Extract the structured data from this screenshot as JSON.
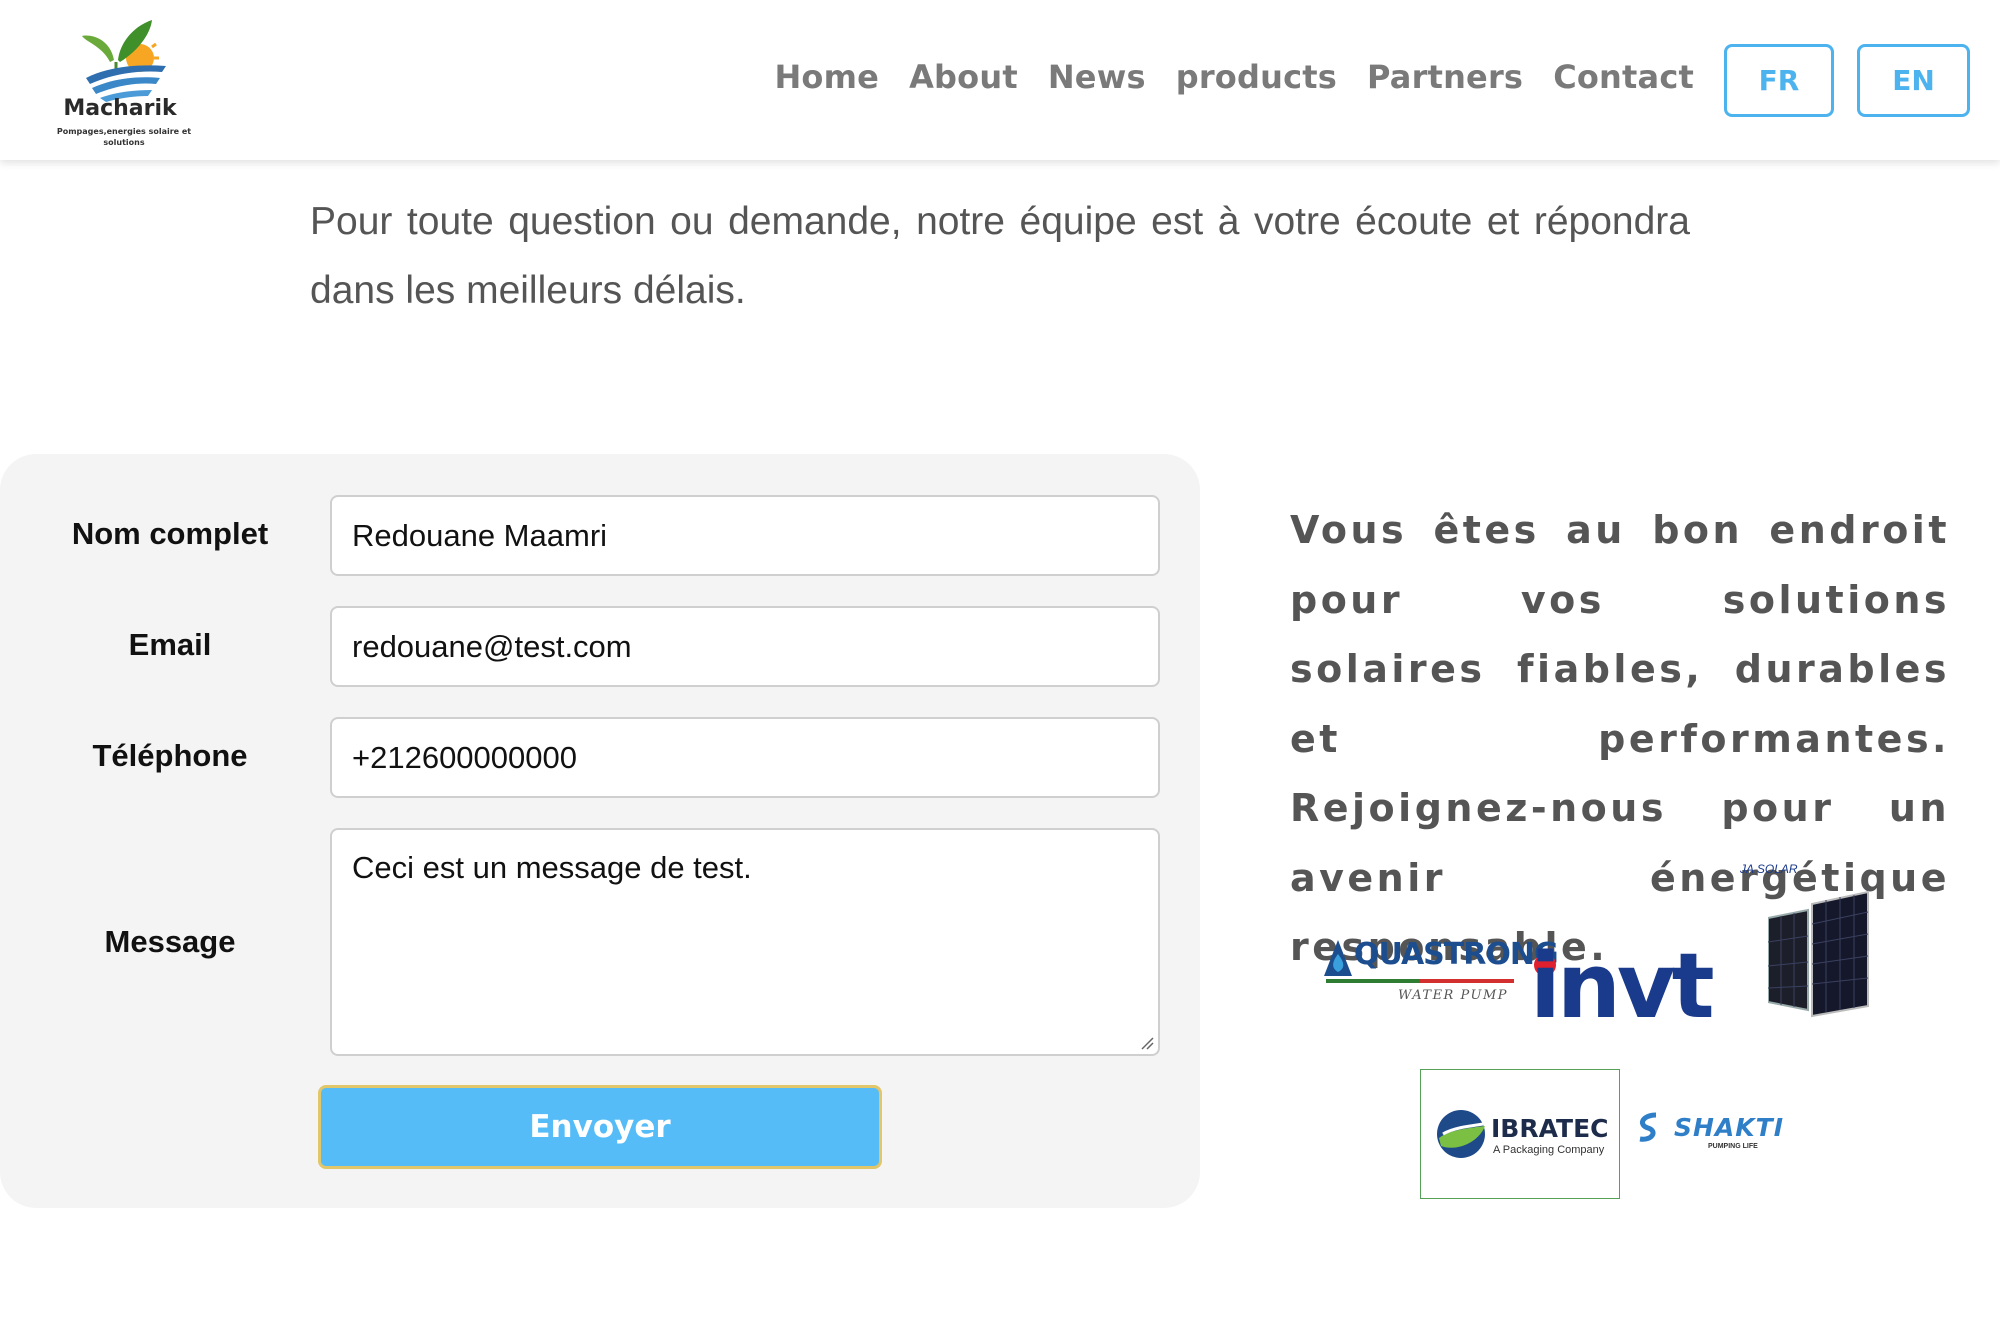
{
  "header": {
    "logo": {
      "name": "Macharik",
      "tagline": "Pompages,energies solaire et solutions"
    },
    "nav": [
      {
        "label": "Home"
      },
      {
        "label": "About"
      },
      {
        "label": "News"
      },
      {
        "label": "products"
      },
      {
        "label": "Partners"
      },
      {
        "label": "Contact"
      }
    ],
    "languages": {
      "fr": "FR",
      "en": "EN"
    }
  },
  "intro": {
    "text": "Pour toute question ou demande, notre équipe est à votre écoute et répondra dans les meilleurs délais."
  },
  "form": {
    "name_label": "Nom complet",
    "name_value": "Redouane Maamri",
    "email_label": "Email",
    "email_value": "redouane@test.com",
    "phone_label": "Téléphone",
    "phone_value": "+212600000000",
    "message_label": "Message",
    "message_value": "Ceci est un message de test.",
    "submit_label": "Envoyer"
  },
  "pitch": {
    "text": "Vous êtes au bon endroit pour vos solutions solaires fiables, durables et performantes. Rejoignez-nous pour un avenir énergétique responsable."
  },
  "partners": {
    "aquastrong": {
      "name": "QUASTRONG",
      "sub": "WATER PUMP"
    },
    "invt": {
      "name": "invt"
    },
    "jasolar": {
      "name": "JA SOLAR"
    },
    "ibratec": {
      "name": "IBRATEC",
      "sub": "A Packaging Company"
    },
    "shakti": {
      "name": "SHAKTI",
      "sub": "PUMPING LIFE"
    }
  },
  "colors": {
    "accent": "#4db3ee",
    "submit": "#56bcf7",
    "nav_text": "#7a7a7a",
    "panel_bg": "#f4f4f4"
  }
}
